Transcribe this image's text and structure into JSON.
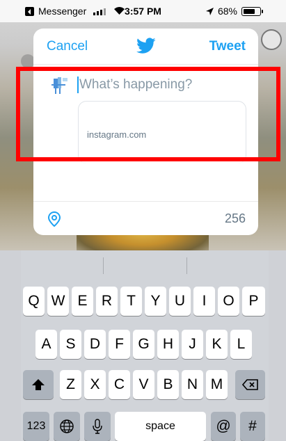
{
  "status_bar": {
    "back_app": "Messenger",
    "time": "3:57 PM",
    "battery": "68%"
  },
  "sheet": {
    "cancel_label": "Cancel",
    "tweet_label": "Tweet",
    "placeholder": "What’s happening?",
    "link_card_domain": "instagram.com",
    "char_count": "256"
  },
  "colors": {
    "accent": "#1da1f2",
    "highlight": "#ff0000"
  },
  "keyboard": {
    "row1": [
      "Q",
      "W",
      "E",
      "R",
      "T",
      "Y",
      "U",
      "I",
      "O",
      "P"
    ],
    "row2": [
      "A",
      "S",
      "D",
      "F",
      "G",
      "H",
      "J",
      "K",
      "L"
    ],
    "row3": [
      "Z",
      "X",
      "C",
      "V",
      "B",
      "N",
      "M"
    ],
    "numbers_label": "123",
    "space_label": "space",
    "at_label": "@",
    "hash_label": "#"
  }
}
